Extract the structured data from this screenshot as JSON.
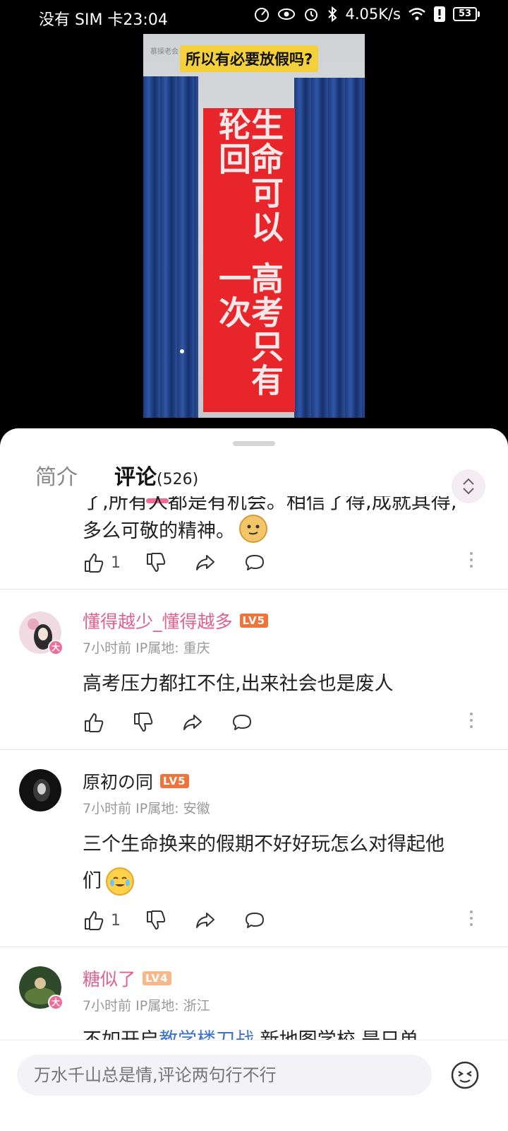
{
  "status_bar": {
    "carrier_time": "没有 SIM 卡23:04",
    "network_speed": "4.05K/s",
    "battery": "53",
    "icons": [
      "speed-icon",
      "eye-icon",
      "alarm-icon",
      "bluetooth-icon",
      "wifi-icon",
      "alert-icon",
      "battery-icon"
    ]
  },
  "video": {
    "caption": "所以有必要放假吗?",
    "watermark": "慕操老会 ...",
    "banner_line1": "生命可以轮回",
    "banner_line2": "高考只有一次"
  },
  "tabs": {
    "intro": "简介",
    "comments": "评论",
    "comments_count": "(526)"
  },
  "comments": [
    {
      "text_cut": "了,所有人都是有机会。相信了得,成就其得,",
      "text": "多么可敬的精神。",
      "emoji": "doge-emoji",
      "likes": "1"
    },
    {
      "username": "懂得越少_懂得越多",
      "level": "LV5",
      "meta": "7小时前  IP属地: 重庆",
      "text": "高考压力都扛不住,出来社会也是废人",
      "likes": ""
    },
    {
      "username": "原初の同",
      "level": "LV5",
      "meta": "7小时前  IP属地: 安徽",
      "text_line1": "三个生命换来的假期不好好玩怎么对得起他",
      "text_line2": "们",
      "emoji": "crying-laughing-emoji",
      "likes": "1"
    },
    {
      "username": "糖似了",
      "level": "LV4",
      "meta": "7小时前  IP属地: 浙江",
      "text_pre": "不如开启",
      "text_link": "教学楼刀战",
      "text_post": ",新地图学校,是只单"
    }
  ],
  "badge_label": "大",
  "input": {
    "placeholder": "万水千山总是情,评论两句行不行"
  },
  "colors": {
    "accent_pink": "#f06b9a",
    "username_pink": "#e0608f",
    "lv5_orange": "#f0733a",
    "lv4_peach": "#f7b98a",
    "link_blue": "#3d74c8"
  }
}
